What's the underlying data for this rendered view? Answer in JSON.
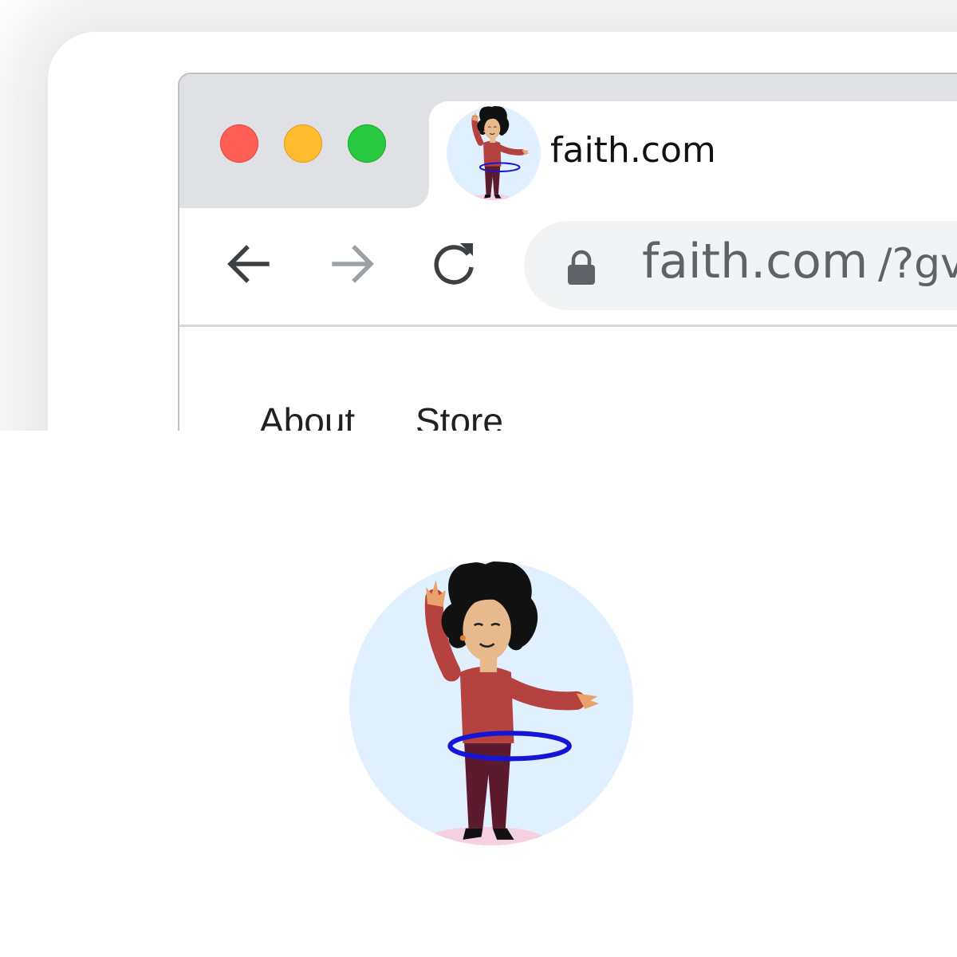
{
  "window": {
    "traffic_lights": {
      "close_color": "#fe5f57",
      "minimize_color": "#febc2e",
      "zoom_color": "#28c840"
    }
  },
  "tab": {
    "title": "faith.com",
    "favicon": "hula-hoop-woman-avatar-icon"
  },
  "toolbar": {
    "back_icon": "arrow-left-icon",
    "forward_icon": "arrow-right-icon",
    "reload_icon": "reload-icon",
    "lock_icon": "lock-icon",
    "url_host": "faith.com",
    "url_path": "/?gv"
  },
  "page": {
    "nav": [
      {
        "label": "About"
      },
      {
        "label": "Store"
      }
    ]
  },
  "hero": {
    "image": "hula-hoop-woman-avatar-icon"
  }
}
